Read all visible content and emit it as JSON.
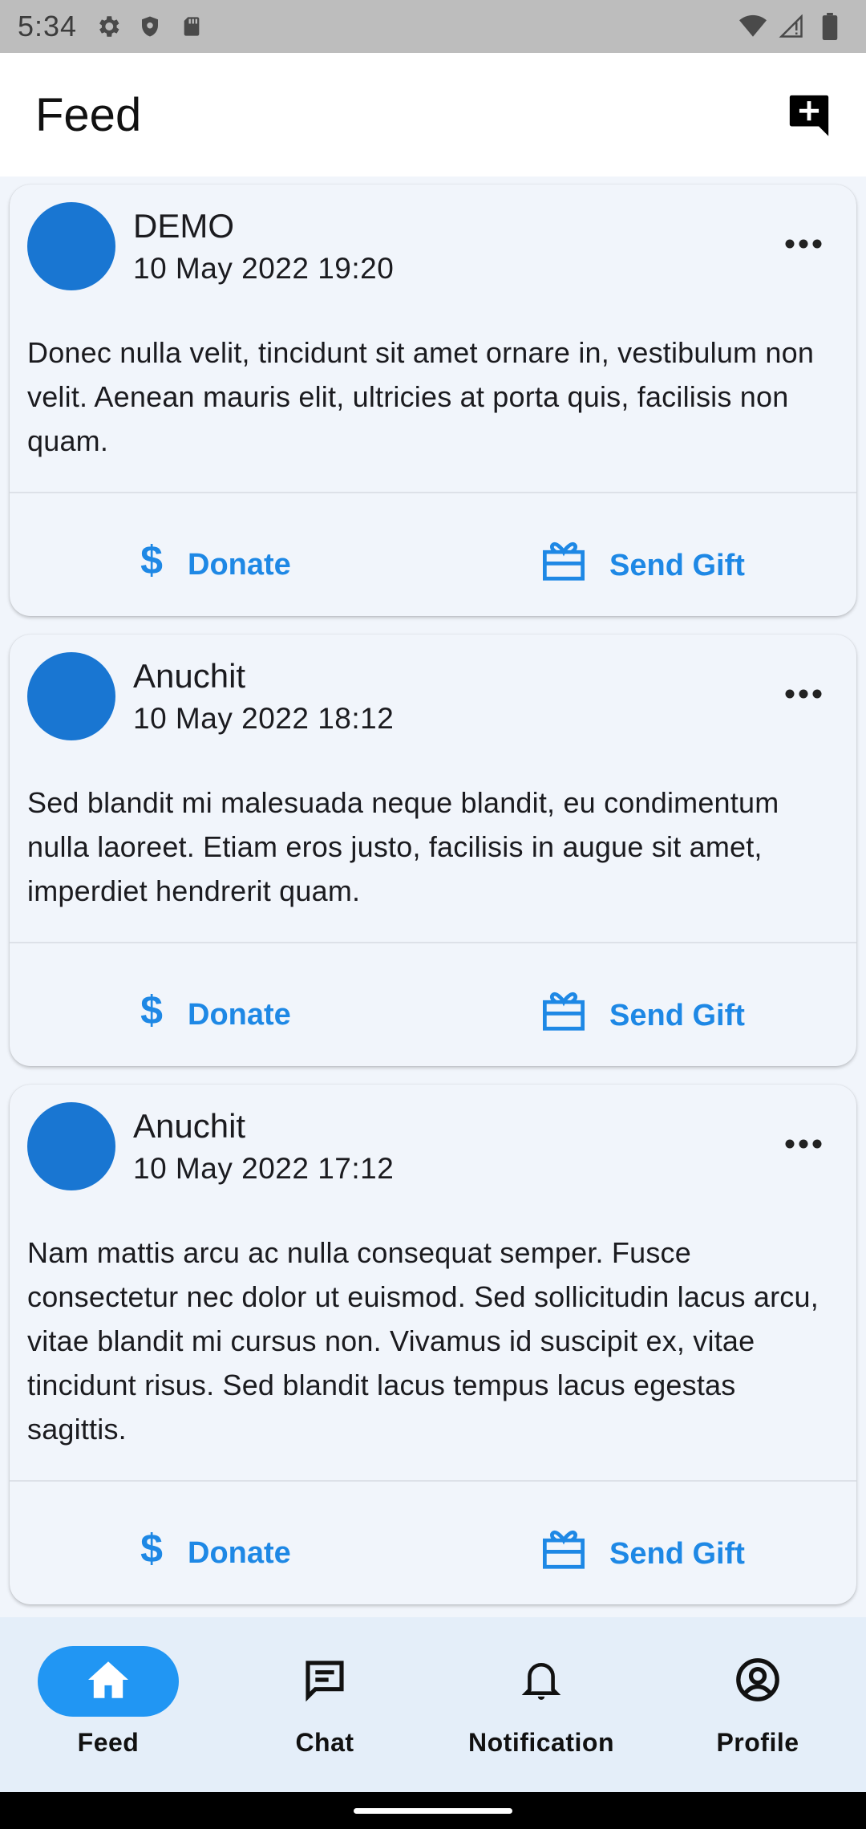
{
  "status_bar": {
    "time": "5:34",
    "icons_left": [
      "settings-icon",
      "shield-icon",
      "sd-card-icon"
    ],
    "icons_right": [
      "wifi-icon",
      "signal-icon",
      "battery-icon"
    ]
  },
  "app_bar": {
    "title": "Feed",
    "action_icon": "add-comment-icon"
  },
  "posts": [
    {
      "author": "DEMO",
      "date": "10 May 2022 19:20",
      "text": "Donec nulla velit, tincidunt sit amet ornare in, vestibulum non velit. Aenean mauris elit, ultricies at porta quis, facilisis non quam.",
      "donate_label": "Donate",
      "gift_label": "Send Gift"
    },
    {
      "author": "Anuchit",
      "date": "10 May 2022 18:12",
      "text": "Sed blandit mi malesuada neque blandit, eu condimentum nulla laoreet. Etiam eros justo, facilisis in augue sit amet, imperdiet hendrerit quam.",
      "donate_label": "Donate",
      "gift_label": "Send Gift"
    },
    {
      "author": "Anuchit",
      "date": "10 May 2022 17:12",
      "text": "Nam mattis arcu ac nulla consequat semper. Fusce consectetur nec dolor ut euismod. Sed sollicitudin lacus arcu, vitae blandit mi cursus non. Vivamus id suscipit ex, vitae tincidunt risus. Sed blandit lacus tempus lacus egestas sagittis.",
      "donate_label": "Donate",
      "gift_label": "Send Gift"
    }
  ],
  "bottom_nav": {
    "items": [
      {
        "label": "Feed",
        "icon": "home-icon",
        "active": true
      },
      {
        "label": "Chat",
        "icon": "chat-icon",
        "active": false
      },
      {
        "label": "Notification",
        "icon": "bell-icon",
        "active": false
      },
      {
        "label": "Profile",
        "icon": "account-circle-icon",
        "active": false
      }
    ]
  },
  "colors": {
    "accent": "#1e88e5",
    "avatar": "#1976d2",
    "nav_active": "#2196f3",
    "background": "#f1f5fb",
    "nav_background": "#e4eef9"
  }
}
